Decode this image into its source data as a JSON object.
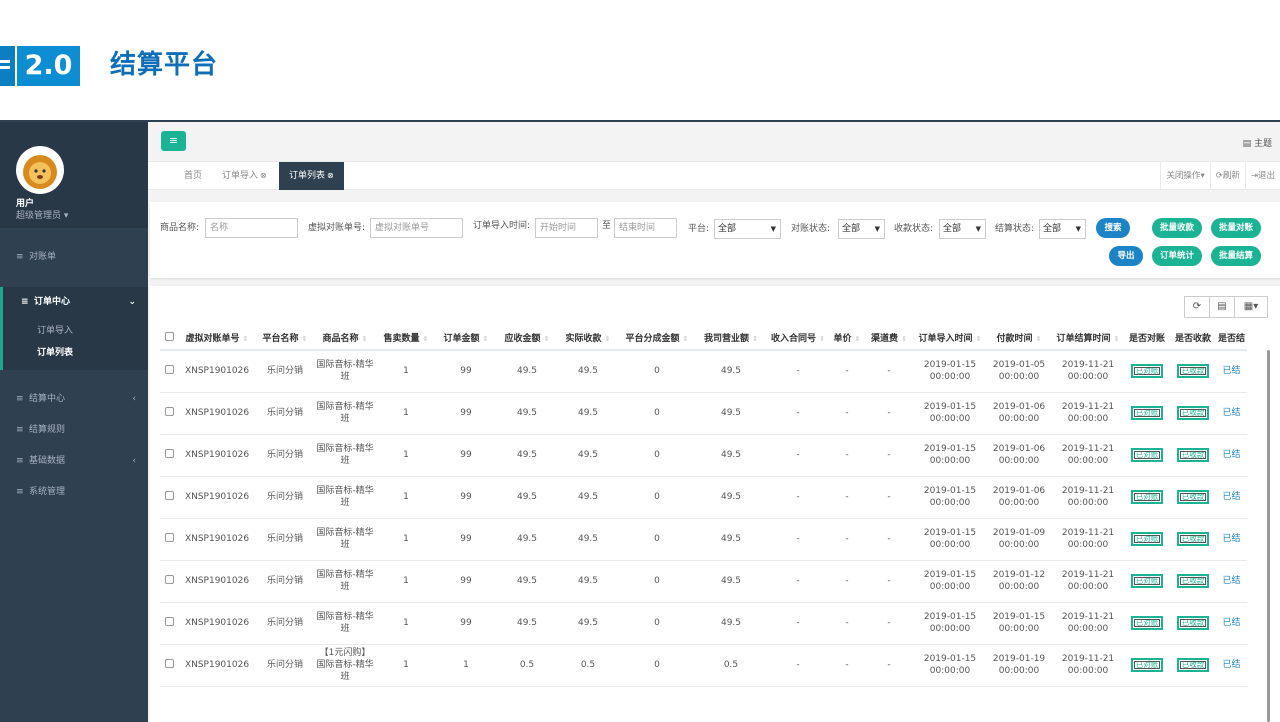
{
  "slide": {
    "version": "2.0",
    "title": "结算平台"
  },
  "header": {
    "menu_icon": "≡",
    "theme_label": "主题"
  },
  "profile": {
    "name": "用户",
    "role": "超级管理员"
  },
  "sidebar": {
    "items": [
      {
        "label": "对账单"
      },
      {
        "label": "订单中心",
        "sub": [
          "订单导入",
          "订单列表"
        ]
      },
      {
        "label": "结算中心"
      },
      {
        "label": "结算规则"
      },
      {
        "label": "基础数据"
      },
      {
        "label": "系统管理"
      }
    ]
  },
  "tabs": {
    "home": "首页",
    "import": "订单导入",
    "list": "订单列表"
  },
  "tab_tools": {
    "close_ops": "关闭操作",
    "refresh": "刷新",
    "logout": "退出"
  },
  "filters": {
    "product_label": "商品名称:",
    "product_placeholder": "名称",
    "virtual_label": "虚拟对账单号:",
    "virtual_placeholder": "虚拟对账单号",
    "time_label": "订单导入时间:",
    "start_placeholder": "开始时间",
    "to": "至",
    "end_placeholder": "结束时间",
    "platform_label": "平台:",
    "platform_value": "全部",
    "recon_label": "对账状态:",
    "recon_value": "全部",
    "receipt_label": "收款状态:",
    "receipt_value": "全部",
    "settle_label": "结算状态:",
    "settle_value": "全部",
    "search": "搜索",
    "export": "导出",
    "batch_receipt": "批量收款",
    "batch_recon": "批量对账",
    "order_stats": "订单统计",
    "batch_settle": "批量结算"
  },
  "table": {
    "columns": [
      "虚拟对账单号",
      "平台名称",
      "商品名称",
      "售卖数量",
      "订单金额",
      "应收金额",
      "实际收款",
      "平台分成金额",
      "我司营业额",
      "收入合同号",
      "单价",
      "渠道费",
      "订单导入时间",
      "付款时间",
      "订单结算时间",
      "是否对账",
      "是否收款",
      "是否结"
    ],
    "rows": [
      {
        "id": "XNSP1901026",
        "platform": "乐问分销",
        "product": "国际音标-精华班",
        "qty": "1",
        "amount": "99",
        "receivable": "49.5",
        "received": "49.5",
        "share": "0",
        "revenue": "49.5",
        "contract": "-",
        "price": "-",
        "channel": "-",
        "import_date": "2019-01-15",
        "import_time": "00:00:00",
        "pay_date": "2019-01-05",
        "pay_time": "00:00:00",
        "settle_date": "2019-11-21",
        "settle_time": "00:00:00",
        "recon": "已对账",
        "receipt": "已收款",
        "settled": "已结"
      },
      {
        "id": "XNSP1901026",
        "platform": "乐问分销",
        "product": "国际音标-精华班",
        "qty": "1",
        "amount": "99",
        "receivable": "49.5",
        "received": "49.5",
        "share": "0",
        "revenue": "49.5",
        "contract": "-",
        "price": "-",
        "channel": "-",
        "import_date": "2019-01-15",
        "import_time": "00:00:00",
        "pay_date": "2019-01-06",
        "pay_time": "00:00:00",
        "settle_date": "2019-11-21",
        "settle_time": "00:00:00",
        "recon": "已对账",
        "receipt": "已收款",
        "settled": "已结"
      },
      {
        "id": "XNSP1901026",
        "platform": "乐问分销",
        "product": "国际音标-精华班",
        "qty": "1",
        "amount": "99",
        "receivable": "49.5",
        "received": "49.5",
        "share": "0",
        "revenue": "49.5",
        "contract": "-",
        "price": "-",
        "channel": "-",
        "import_date": "2019-01-15",
        "import_time": "00:00:00",
        "pay_date": "2019-01-06",
        "pay_time": "00:00:00",
        "settle_date": "2019-11-21",
        "settle_time": "00:00:00",
        "recon": "已对账",
        "receipt": "已收款",
        "settled": "已结"
      },
      {
        "id": "XNSP1901026",
        "platform": "乐问分销",
        "product": "国际音标-精华班",
        "qty": "1",
        "amount": "99",
        "receivable": "49.5",
        "received": "49.5",
        "share": "0",
        "revenue": "49.5",
        "contract": "-",
        "price": "-",
        "channel": "-",
        "import_date": "2019-01-15",
        "import_time": "00:00:00",
        "pay_date": "2019-01-06",
        "pay_time": "00:00:00",
        "settle_date": "2019-11-21",
        "settle_time": "00:00:00",
        "recon": "已对账",
        "receipt": "已收款",
        "settled": "已结"
      },
      {
        "id": "XNSP1901026",
        "platform": "乐问分销",
        "product": "国际音标-精华班",
        "qty": "1",
        "amount": "99",
        "receivable": "49.5",
        "received": "49.5",
        "share": "0",
        "revenue": "49.5",
        "contract": "-",
        "price": "-",
        "channel": "-",
        "import_date": "2019-01-15",
        "import_time": "00:00:00",
        "pay_date": "2019-01-09",
        "pay_time": "00:00:00",
        "settle_date": "2019-11-21",
        "settle_time": "00:00:00",
        "recon": "已对账",
        "receipt": "已收款",
        "settled": "已结"
      },
      {
        "id": "XNSP1901026",
        "platform": "乐问分销",
        "product": "国际音标-精华班",
        "qty": "1",
        "amount": "99",
        "receivable": "49.5",
        "received": "49.5",
        "share": "0",
        "revenue": "49.5",
        "contract": "-",
        "price": "-",
        "channel": "-",
        "import_date": "2019-01-15",
        "import_time": "00:00:00",
        "pay_date": "2019-01-12",
        "pay_time": "00:00:00",
        "settle_date": "2019-11-21",
        "settle_time": "00:00:00",
        "recon": "已对账",
        "receipt": "已收款",
        "settled": "已结"
      },
      {
        "id": "XNSP1901026",
        "platform": "乐问分销",
        "product": "国际音标-精华班",
        "qty": "1",
        "amount": "99",
        "receivable": "49.5",
        "received": "49.5",
        "share": "0",
        "revenue": "49.5",
        "contract": "-",
        "price": "-",
        "channel": "-",
        "import_date": "2019-01-15",
        "import_time": "00:00:00",
        "pay_date": "2019-01-15",
        "pay_time": "00:00:00",
        "settle_date": "2019-11-21",
        "settle_time": "00:00:00",
        "recon": "已对账",
        "receipt": "已收款",
        "settled": "已结"
      },
      {
        "id": "XNSP1901026",
        "platform": "乐问分销",
        "product": "【1元闪购】国际音标-精华班",
        "qty": "1",
        "amount": "1",
        "receivable": "0.5",
        "received": "0.5",
        "share": "0",
        "revenue": "0.5",
        "contract": "-",
        "price": "-",
        "channel": "-",
        "import_date": "2019-01-15",
        "import_time": "00:00:00",
        "pay_date": "2019-01-19",
        "pay_time": "00:00:00",
        "settle_date": "2019-11-21",
        "settle_time": "00:00:00",
        "recon": "已对账",
        "receipt": "已收款",
        "settled": "已结"
      }
    ]
  }
}
